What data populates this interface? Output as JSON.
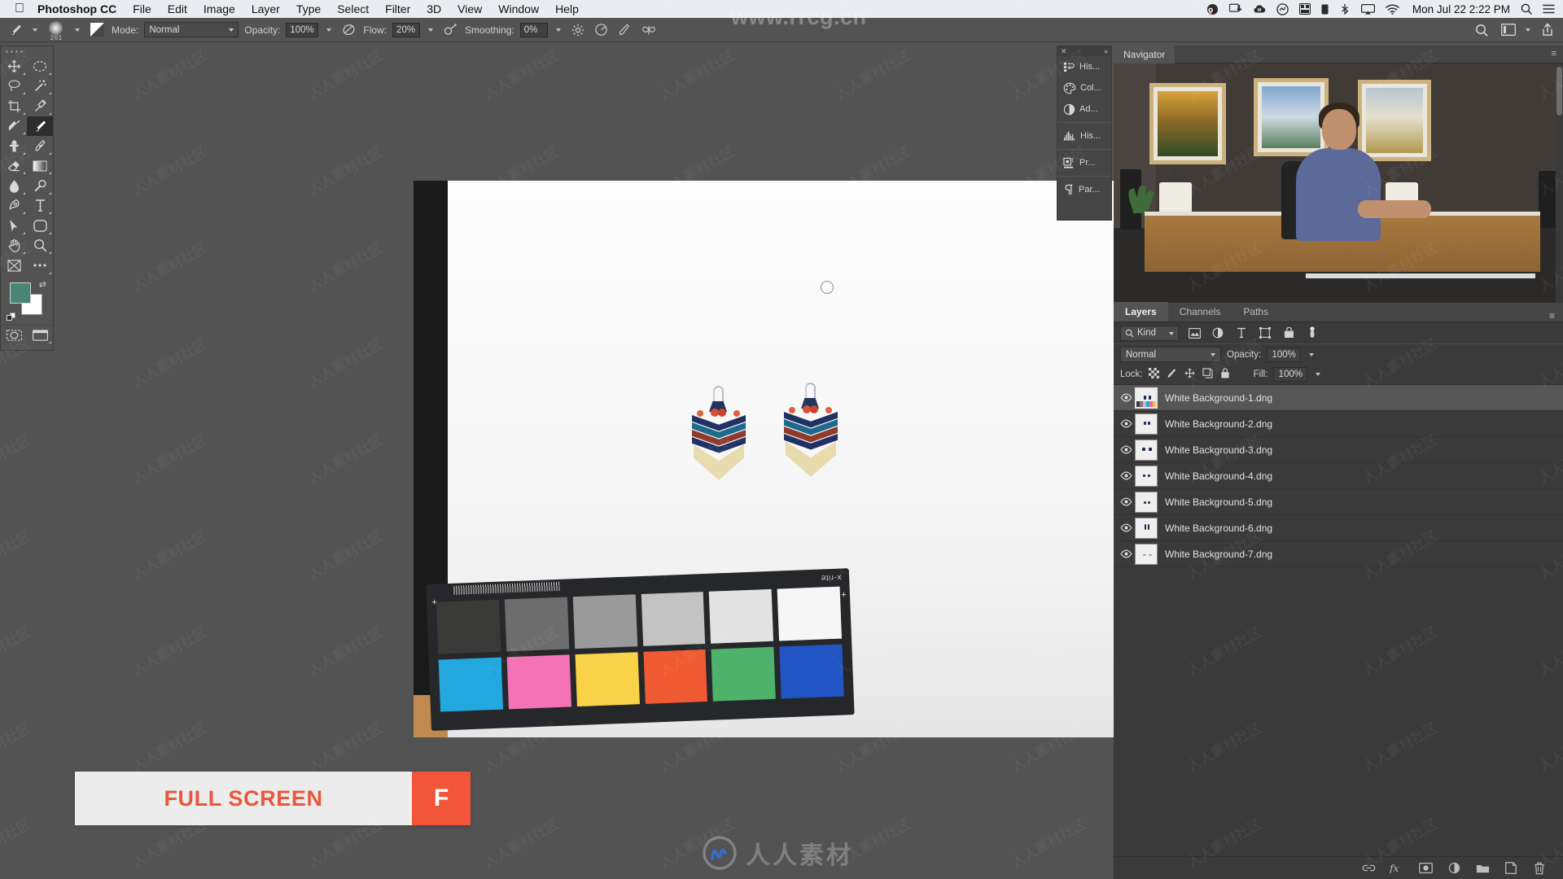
{
  "macbar": {
    "apple_icon": "apple-logo-icon",
    "app_name": "Photoshop CC",
    "menus": [
      "File",
      "Edit",
      "Image",
      "Layer",
      "Type",
      "Select",
      "Filter",
      "3D",
      "View",
      "Window",
      "Help"
    ],
    "status_icons": [
      "obs-icon",
      "screen-download-icon",
      "dropbox-cloud-icon",
      "creative-cloud-icon",
      "grid-icon",
      "battery-icon",
      "bluetooth-icon",
      "airplay-icon",
      "wifi-icon"
    ],
    "clock": "Mon Jul 22  2:22 PM",
    "search_icon": "search-icon",
    "control_center_icon": "control-center-icon"
  },
  "options_bar": {
    "tool_icon": "brush-tool-icon",
    "brush_size": "261",
    "brush_preset_icon": "brush-preset-icon",
    "mode_label": "Mode:",
    "mode_value": "Normal",
    "opacity_label": "Opacity:",
    "opacity_value": "100%",
    "opacity_pressure_icon": "pressure-opacity-icon",
    "flow_label": "Flow:",
    "flow_value": "20%",
    "airbrush_icon": "airbrush-icon",
    "smoothing_label": "Smoothing:",
    "smoothing_value": "0%",
    "smoothing_options_icon": "gear-icon",
    "angle_icon": "brush-angle-icon",
    "tablet_pressure_icon": "tablet-pressure-icon",
    "symmetry_icon": "symmetry-butterfly-icon",
    "search_icon": "search-icon",
    "workspace_icon": "workspace-icon",
    "share_icon": "share-icon"
  },
  "tools": [
    {
      "name": "move-tool",
      "icon": "move-icon"
    },
    {
      "name": "elliptical-marquee-tool",
      "icon": "ellipse-marquee-icon"
    },
    {
      "name": "lasso-tool",
      "icon": "lasso-icon"
    },
    {
      "name": "magic-wand-tool",
      "icon": "magic-wand-icon"
    },
    {
      "name": "crop-tool",
      "icon": "crop-icon"
    },
    {
      "name": "eyedropper-tool",
      "icon": "eyedropper-icon"
    },
    {
      "name": "spot-healing-brush-tool",
      "icon": "healing-brush-icon"
    },
    {
      "name": "brush-tool",
      "icon": "brush-icon"
    },
    {
      "name": "clone-stamp-tool",
      "icon": "clone-stamp-icon"
    },
    {
      "name": "history-brush-tool",
      "icon": "history-brush-icon"
    },
    {
      "name": "eraser-tool",
      "icon": "eraser-icon"
    },
    {
      "name": "gradient-tool",
      "icon": "gradient-icon"
    },
    {
      "name": "blur-tool",
      "icon": "blur-droplet-icon"
    },
    {
      "name": "dodge-tool",
      "icon": "dodge-icon"
    },
    {
      "name": "pen-tool",
      "icon": "pen-icon"
    },
    {
      "name": "type-tool",
      "icon": "type-t-icon"
    },
    {
      "name": "path-selection-tool",
      "icon": "path-arrow-icon"
    },
    {
      "name": "rectangle-tool",
      "icon": "rounded-rectangle-icon"
    },
    {
      "name": "hand-tool",
      "icon": "hand-icon"
    },
    {
      "name": "zoom-tool",
      "icon": "magnifier-icon"
    },
    {
      "name": "edit-toolbar",
      "icon": "frame-icon"
    },
    {
      "name": "more-tools",
      "icon": "ellipsis-icon"
    }
  ],
  "tool_swatches": {
    "foreground_color": "#4b8577",
    "background_color": "#ffffff",
    "swap_icon": "swap-colors-icon",
    "default_icon": "default-colors-icon",
    "quick_mask_icon": "quick-mask-icon",
    "screen_mode_icon": "screen-mode-icon"
  },
  "mini_dock": {
    "close_icon": "close-icon",
    "expand_icon": "expand-panels-icon",
    "items": [
      {
        "label": "His...",
        "icon": "history-icon"
      },
      {
        "label": "Col...",
        "icon": "color-palette-icon"
      },
      {
        "label": "Ad...",
        "icon": "adjustments-icon"
      },
      {
        "label": "His...",
        "icon": "histogram-icon"
      },
      {
        "label": "Pr...",
        "icon": "properties-icon"
      },
      {
        "label": "Par...",
        "icon": "paragraph-icon"
      }
    ]
  },
  "navigator": {
    "tab_label": "Navigator",
    "menu_icon": "panel-menu-icon",
    "scrollbar": "vertical-scrollbar"
  },
  "layers_panel": {
    "tabs": [
      {
        "label": "Layers",
        "active": true
      },
      {
        "label": "Channels",
        "active": false
      },
      {
        "label": "Paths",
        "active": false
      }
    ],
    "menu_icon": "panel-menu-icon",
    "filter_kind": "Kind",
    "filter_search_icon": "search-icon",
    "filter_icons": [
      "pixel-layer-filter-icon",
      "adjustment-layer-filter-icon",
      "type-layer-filter-icon",
      "shape-layer-filter-icon",
      "smart-object-filter-icon",
      "filter-toggle-icon"
    ],
    "blend_mode": "Normal",
    "opacity_label": "Opacity:",
    "opacity_value": "100%",
    "lock_label": "Lock:",
    "lock_icons": [
      "lock-transparent-pixels-icon",
      "lock-image-pixels-icon",
      "lock-position-icon",
      "lock-artboard-icon",
      "lock-all-icon"
    ],
    "fill_label": "Fill:",
    "fill_value": "100%",
    "layers": [
      {
        "name": "White Background-1.dng",
        "visible": true,
        "selected": true
      },
      {
        "name": "White Background-2.dng",
        "visible": true,
        "selected": false
      },
      {
        "name": "White Background-3.dng",
        "visible": true,
        "selected": false
      },
      {
        "name": "White Background-4.dng",
        "visible": true,
        "selected": false
      },
      {
        "name": "White Background-5.dng",
        "visible": true,
        "selected": false
      },
      {
        "name": "White Background-6.dng",
        "visible": true,
        "selected": false
      },
      {
        "name": "White Background-7.dng",
        "visible": true,
        "selected": false
      }
    ],
    "bottom_icons": [
      "link-layers-icon",
      "layer-style-fx-icon",
      "add-layer-mask-icon",
      "new-adjustment-layer-icon",
      "new-group-icon",
      "new-layer-icon",
      "delete-layer-icon"
    ]
  },
  "canvas": {
    "brush_cursor": "brush-cursor-ring",
    "subject": "macrame-chevron-earrings",
    "color_checker": {
      "brand": "x-rite",
      "gray_row": [
        "#3a3a38",
        "#6d6d6d",
        "#9a9a9a",
        "#c3c3c3",
        "#e2e2e2",
        "#f6f6f6"
      ],
      "color_row": [
        "#22a8de",
        "#f373b6",
        "#f8d348",
        "#f05a32",
        "#4fb26a",
        "#2255c4"
      ]
    }
  },
  "overlay_banner": {
    "label": "FULL SCREEN",
    "key": "F",
    "accent_color": "#f2553a",
    "text_color": "#e8583c"
  },
  "watermarks": {
    "top": "www.rrcg.cn",
    "bottom": "人人素材",
    "tile": "人人素材社区",
    "logo": "rrcg-logo-icon"
  }
}
